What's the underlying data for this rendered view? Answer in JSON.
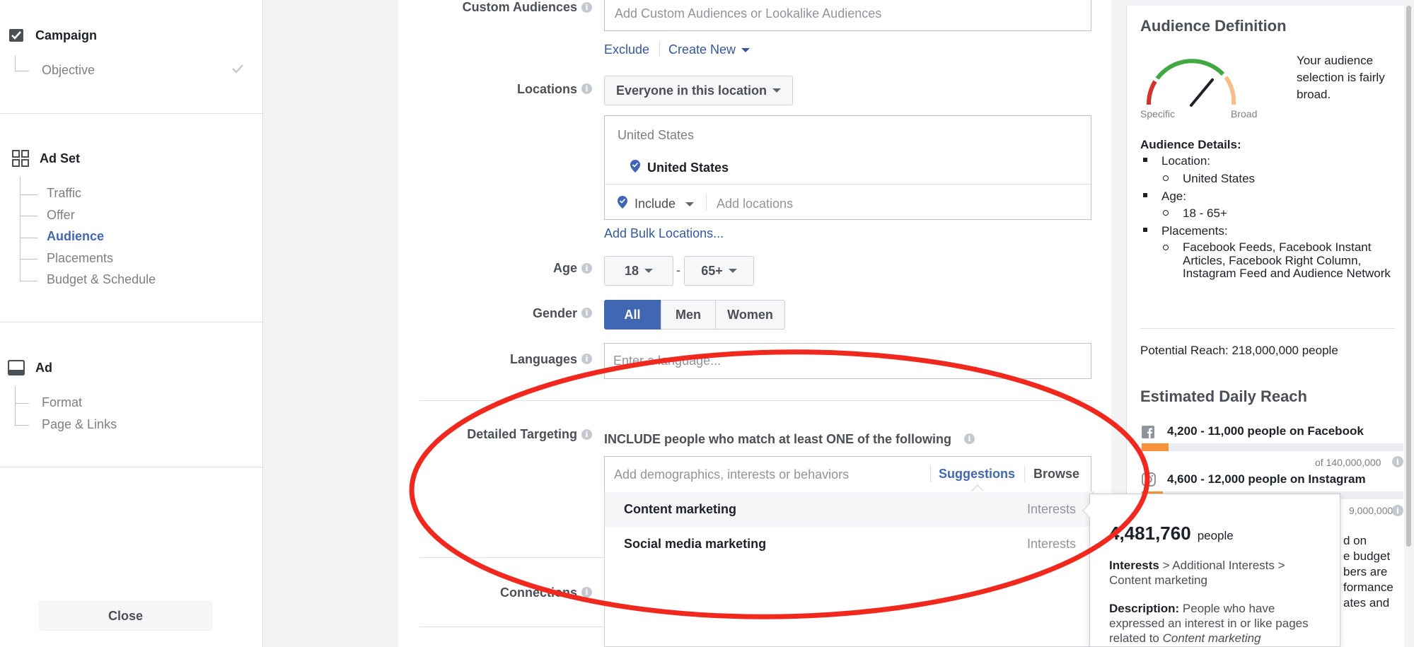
{
  "sidebar": {
    "campaign": {
      "label": "Campaign",
      "items": [
        "Objective"
      ]
    },
    "adset": {
      "label": "Ad Set",
      "items": [
        "Traffic",
        "Offer",
        "Audience",
        "Placements",
        "Budget & Schedule"
      ],
      "active": "Audience"
    },
    "ad": {
      "label": "Ad",
      "items": [
        "Format",
        "Page & Links"
      ]
    },
    "close_label": "Close"
  },
  "form": {
    "custom_audiences": {
      "label": "Custom Audiences",
      "placeholder": "Add Custom Audiences or Lookalike Audiences",
      "exclude": "Exclude",
      "create_new": "Create New"
    },
    "locations": {
      "label": "Locations",
      "dropdown": "Everyone in this location",
      "country_header": "United States",
      "country": "United States",
      "include": "Include",
      "placeholder": "Add locations",
      "bulk": "Add Bulk Locations..."
    },
    "age": {
      "label": "Age",
      "min": "18",
      "sep": "-",
      "max": "65+"
    },
    "gender": {
      "label": "Gender",
      "options": [
        "All",
        "Men",
        "Women"
      ],
      "selected": "All"
    },
    "languages": {
      "label": "Languages",
      "placeholder": "Enter a language..."
    },
    "detailed_targeting": {
      "label": "Detailed Targeting",
      "include_text": "INCLUDE people who match at least ONE of the following",
      "placeholder": "Add demographics, interests or behaviors",
      "suggestions": "Suggestions",
      "browse": "Browse",
      "results": [
        {
          "name": "Content marketing",
          "category": "Interests"
        },
        {
          "name": "Social media marketing",
          "category": "Interests"
        }
      ]
    },
    "connections": {
      "label": "Connections"
    }
  },
  "tooltip": {
    "size": "4,481,760",
    "size_unit": "people",
    "path_bold": "Interests",
    "path_rest": " > Additional Interests > Content marketing",
    "desc_label": "Description:",
    "desc_text": " People who have expressed an interest in or like pages related to ",
    "desc_em": "Content marketing"
  },
  "audience": {
    "title": "Audience Definition",
    "gauge_specific": "Specific",
    "gauge_broad": "Broad",
    "gauge_level": 0.72,
    "summary": "Your audience selection is fairly broad.",
    "details_title": "Audience Details:",
    "location_label": "Location:",
    "location_value": "United States",
    "age_label": "Age:",
    "age_value": "18 - 65+",
    "placements_label": "Placements:",
    "placements_value": "Facebook Feeds, Facebook Instant Articles, Facebook Right Column, Instagram Feed and Audience Network",
    "potential_reach": "Potential Reach: 218,000,000 people",
    "daily_title": "Estimated Daily Reach",
    "facebook_reach": "4,200 - 11,000 people on Facebook",
    "fb_axis_min": "0",
    "fb_axis_max": "of 140,000,000",
    "instagram_reach": "4,600 - 12,000 people on Instagram",
    "ig_axis_max_partial": "9,000,000",
    "partial_lines": [
      "d on",
      "e budget",
      "bers are",
      "formance",
      "ates and"
    ]
  },
  "colors": {
    "accent": "#4267b2",
    "link": "#365899",
    "annotation": "#f0281e",
    "bar": "#f7923a"
  }
}
